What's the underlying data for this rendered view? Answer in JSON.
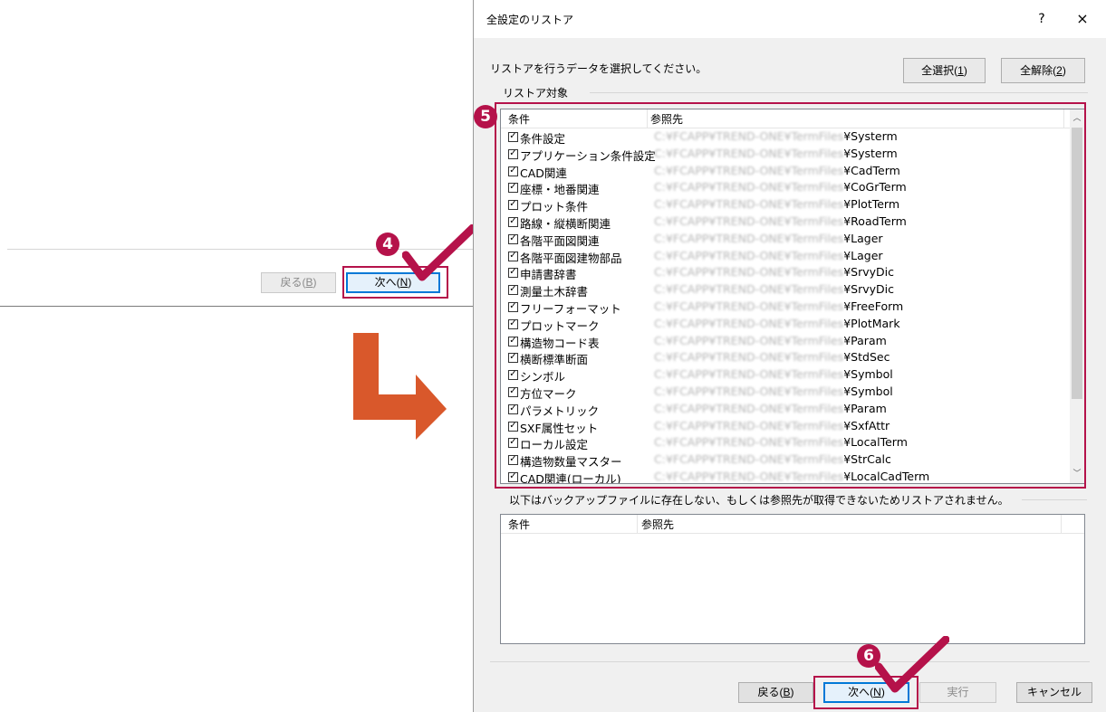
{
  "previous_dialog": {
    "back_label": "戻る(",
    "back_key": "B",
    "next_label": "次へ(",
    "next_key": "N"
  },
  "dialog": {
    "title": "全設定のリストア",
    "help": "?",
    "close": "×",
    "instruction": "リストアを行うデータを選択してください。",
    "select_all_label": "全選択(",
    "select_all_key": "1",
    "deselect_all_label": "全解除(",
    "deselect_all_key": "2",
    "group_label": "リストア対象",
    "columns": {
      "condition": "条件",
      "reference": "参照先"
    },
    "path_prefix": "C:¥FCAPP¥TREND-ONE¥TermFiles",
    "rows": [
      {
        "condition": "条件設定",
        "suffix": "¥Systerm"
      },
      {
        "condition": "アプリケーション条件設定",
        "suffix": "¥Systerm"
      },
      {
        "condition": "CAD関連",
        "suffix": "¥CadTerm"
      },
      {
        "condition": "座標・地番関連",
        "suffix": "¥CoGrTerm"
      },
      {
        "condition": "プロット条件",
        "suffix": "¥PlotTerm"
      },
      {
        "condition": "路線・縦横断関連",
        "suffix": "¥RoadTerm"
      },
      {
        "condition": "各階平面図関連",
        "suffix": "¥Lager"
      },
      {
        "condition": "各階平面図建物部品",
        "suffix": "¥Lager"
      },
      {
        "condition": "申請書辞書",
        "suffix": "¥SrvyDic"
      },
      {
        "condition": "測量土木辞書",
        "suffix": "¥SrvyDic"
      },
      {
        "condition": "フリーフォーマット",
        "suffix": "¥FreeForm"
      },
      {
        "condition": "プロットマーク",
        "suffix": "¥PlotMark"
      },
      {
        "condition": "構造物コード表",
        "suffix": "¥Param"
      },
      {
        "condition": "横断標準断面",
        "suffix": "¥StdSec"
      },
      {
        "condition": "シンボル",
        "suffix": "¥Symbol"
      },
      {
        "condition": "方位マーク",
        "suffix": "¥Symbol"
      },
      {
        "condition": "パラメトリック",
        "suffix": "¥Param"
      },
      {
        "condition": "SXF属性セット",
        "suffix": "¥SxfAttr"
      },
      {
        "condition": "ローカル設定",
        "suffix": "¥LocalTerm"
      },
      {
        "condition": "構造物数量マスター",
        "suffix": "¥StrCalc"
      },
      {
        "condition": "CAD関連(ローカル)",
        "suffix": "¥LocalCadTerm"
      }
    ],
    "skip_note": "以下はバックアップファイルに存在しない、もしくは参照先が取得できないためリストアされません。",
    "skip_columns": {
      "condition": "条件",
      "reference": "参照先"
    },
    "back_label": "戻る(",
    "back_key": "B",
    "next_label": "次へ(",
    "next_key": "N",
    "execute_label": "実行",
    "cancel_label": "キャンセル"
  },
  "annotations": {
    "step4": "4",
    "step5": "5",
    "step6": "6",
    "accent_color": "#b5124a",
    "arrow_color": "#d9582b"
  }
}
